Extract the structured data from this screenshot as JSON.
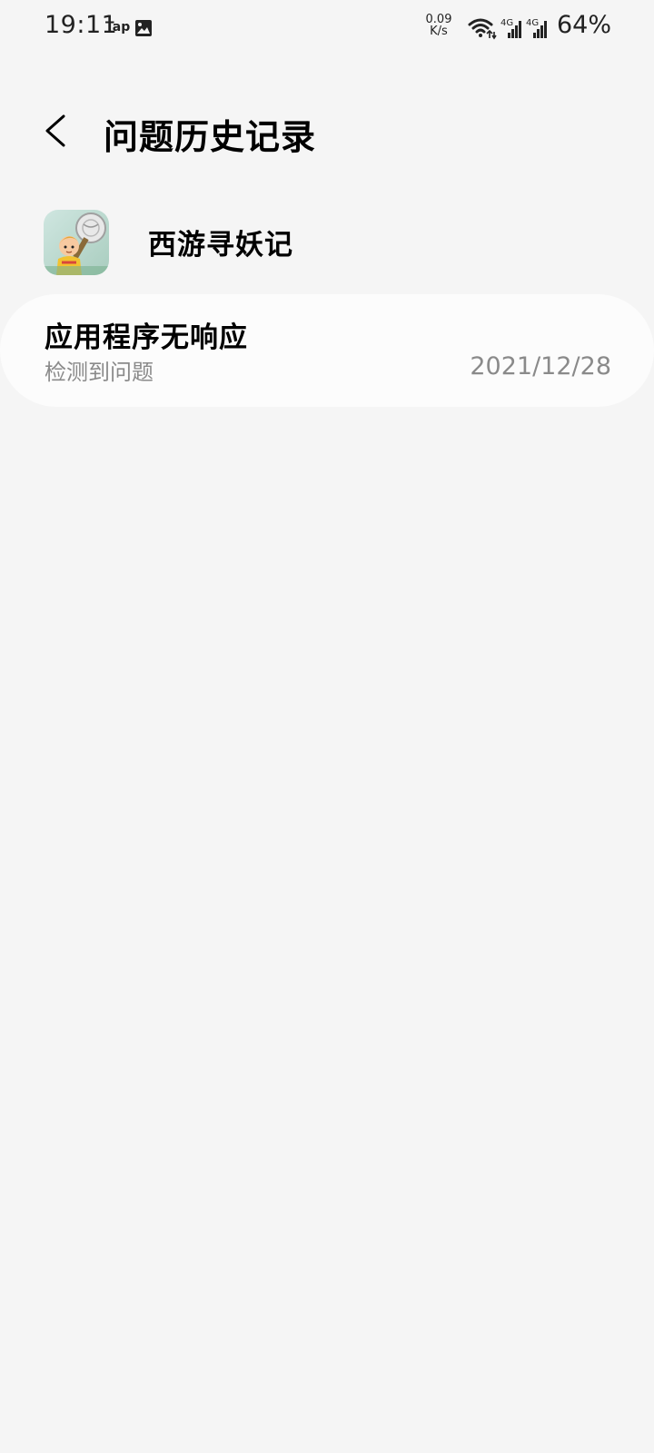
{
  "status_bar": {
    "time": "19:11",
    "tap_label": "Tap",
    "image_icon": "image-icon",
    "speed_value": "0.09",
    "speed_unit": "K/s",
    "wifi_icon": "wifi-icon",
    "signal_label_1": "4G",
    "signal_label_2": "4G",
    "battery": "64%"
  },
  "header": {
    "back_icon": "chevron-left-icon",
    "title": "问题历史记录"
  },
  "app": {
    "name": "西游寻妖记",
    "icon": "app-icon"
  },
  "problem": {
    "title": "应用程序无响应",
    "subtitle": "检测到问题",
    "date": "2021/12/28"
  },
  "colors": {
    "background": "#f5f5f5",
    "card": "#fcfcfc",
    "secondary_text": "#8a8a8a",
    "primary_text": "#000000"
  }
}
